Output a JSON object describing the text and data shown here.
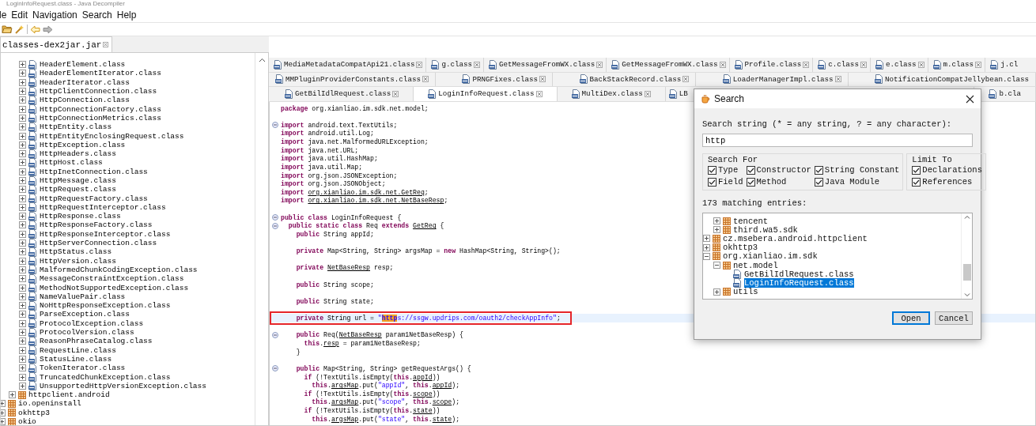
{
  "window": {
    "title": "LoginInfoRequest.class - Java Decompiler"
  },
  "menu": [
    "le",
    "Edit",
    "Navigation",
    "Search",
    "Help"
  ],
  "side_tab": {
    "label": "classes-dex2jar.jar"
  },
  "tree": [
    {
      "children": [
        {
          "children": [
            {
              "label": "HeaderElement.class",
              "kind": "class",
              "expanded": false
            },
            {
              "label": "HeaderElementIterator.class",
              "kind": "class",
              "expanded": false
            },
            {
              "label": "HeaderIterator.class",
              "kind": "class",
              "expanded": false
            },
            {
              "label": "HttpClientConnection.class",
              "kind": "class",
              "expanded": false
            },
            {
              "label": "HttpConnection.class",
              "kind": "class",
              "expanded": false
            },
            {
              "label": "HttpConnectionFactory.class",
              "kind": "class",
              "expanded": false
            },
            {
              "label": "HttpConnectionMetrics.class",
              "kind": "class",
              "expanded": false
            },
            {
              "label": "HttpEntity.class",
              "kind": "class",
              "expanded": false
            },
            {
              "label": "HttpEntityEnclosingRequest.class",
              "kind": "class",
              "expanded": false
            },
            {
              "label": "HttpException.class",
              "kind": "class",
              "expanded": false
            },
            {
              "label": "HttpHeaders.class",
              "kind": "class",
              "expanded": false
            },
            {
              "label": "HttpHost.class",
              "kind": "class",
              "expanded": false
            },
            {
              "label": "HttpInetConnection.class",
              "kind": "class",
              "expanded": false
            },
            {
              "label": "HttpMessage.class",
              "kind": "class",
              "expanded": false
            },
            {
              "label": "HttpRequest.class",
              "kind": "class",
              "expanded": false
            },
            {
              "label": "HttpRequestFactory.class",
              "kind": "class",
              "expanded": false
            },
            {
              "label": "HttpRequestInterceptor.class",
              "kind": "class",
              "expanded": false
            },
            {
              "label": "HttpResponse.class",
              "kind": "class",
              "expanded": false
            },
            {
              "label": "HttpResponseFactory.class",
              "kind": "class",
              "expanded": false
            },
            {
              "label": "HttpResponseInterceptor.class",
              "kind": "class",
              "expanded": false
            },
            {
              "label": "HttpServerConnection.class",
              "kind": "class",
              "expanded": false
            },
            {
              "label": "HttpStatus.class",
              "kind": "class",
              "expanded": false
            },
            {
              "label": "HttpVersion.class",
              "kind": "class",
              "expanded": false
            },
            {
              "label": "MalformedChunkCodingException.class",
              "kind": "class",
              "expanded": false
            },
            {
              "label": "MessageConstraintException.class",
              "kind": "class",
              "expanded": false
            },
            {
              "label": "MethodNotSupportedException.class",
              "kind": "class",
              "expanded": false
            },
            {
              "label": "NameValuePair.class",
              "kind": "class",
              "expanded": false
            },
            {
              "label": "NoHttpResponseException.class",
              "kind": "class",
              "expanded": false
            },
            {
              "label": "ParseException.class",
              "kind": "class",
              "expanded": false
            },
            {
              "label": "ProtocolException.class",
              "kind": "class",
              "expanded": false
            },
            {
              "label": "ProtocolVersion.class",
              "kind": "class",
              "expanded": false
            },
            {
              "label": "ReasonPhraseCatalog.class",
              "kind": "class",
              "expanded": false
            },
            {
              "label": "RequestLine.class",
              "kind": "class",
              "expanded": false
            },
            {
              "label": "StatusLine.class",
              "kind": "class",
              "expanded": false
            },
            {
              "label": "TokenIterator.class",
              "kind": "class",
              "expanded": false
            },
            {
              "label": "TruncatedChunkException.class",
              "kind": "class",
              "expanded": false
            },
            {
              "label": "UnsupportedHttpVersionException.class",
              "kind": "class",
              "expanded": false
            }
          ]
        },
        {
          "label": "httpclient.android",
          "kind": "package",
          "expanded": false
        }
      ]
    },
    {
      "label": "io.openinstall",
      "kind": "package",
      "expanded": false
    },
    {
      "label": "okhttp3",
      "kind": "package",
      "expanded": false
    },
    {
      "label": "okio",
      "kind": "package",
      "expanded": false
    }
  ],
  "tab_rows": [
    {
      "tabs": [
        {
          "label": "MediaMetadataCompatApi21.class",
          "selected": false,
          "closable": true
        },
        {
          "label": "g.class",
          "selected": false,
          "closable": true
        },
        {
          "label": "GetMessageFromWX.class",
          "selected": false,
          "closable": true
        },
        {
          "label": "GetMessageFromWX.class",
          "selected": false,
          "closable": true
        },
        {
          "label": "Profile.class",
          "selected": false,
          "closable": true
        },
        {
          "label": "c.class",
          "selected": false,
          "closable": true
        },
        {
          "label": "e.class",
          "selected": false,
          "closable": true
        },
        {
          "label": "m.class",
          "selected": false,
          "closable": true
        },
        {
          "label": "j.cl",
          "selected": false,
          "closable": false
        }
      ]
    },
    {
      "tabs": [
        {
          "label": "MMPluginProviderConstants.class",
          "selected": false,
          "closable": true
        },
        {
          "label": "PRNGFixes.class",
          "selected": false,
          "closable": true
        },
        {
          "label": "BackStackRecord.class",
          "selected": false,
          "closable": true
        },
        {
          "label": "LoaderManagerImpl.class",
          "selected": false,
          "closable": true
        },
        {
          "label": "NotificationCompatJellybean.class",
          "selected": false,
          "closable": false
        }
      ]
    },
    {
      "tabs": [
        {
          "label": "GetBilIdlRequest.class",
          "selected": false,
          "closable": true
        },
        {
          "label": "LoginInfoRequest.class",
          "selected": true,
          "closable": true
        },
        {
          "label": "MultiDex.class",
          "selected": false,
          "closable": true
        },
        {
          "label": "LB",
          "selected": false,
          "closable": false
        },
        {
          "label": "b.cla",
          "selected": false,
          "closable": false
        }
      ]
    }
  ],
  "code": {
    "lines": [
      {
        "kind": "code",
        "tokens": [
          {
            "kind": "kw",
            "text": "package"
          },
          {
            "kind": "plain",
            "text": " org.xianliao.im.sdk.net.model;"
          }
        ]
      },
      {
        "kind": "blank"
      },
      {
        "kind": "code",
        "fold": true,
        "tokens": [
          {
            "kind": "kw",
            "text": "import"
          },
          {
            "kind": "plain",
            "text": " android.text.TextUtils;"
          }
        ]
      },
      {
        "kind": "code",
        "tokens": [
          {
            "kind": "kw",
            "text": "import"
          },
          {
            "kind": "plain",
            "text": " android.util.Log;"
          }
        ]
      },
      {
        "kind": "code",
        "tokens": [
          {
            "kind": "kw",
            "text": "import"
          },
          {
            "kind": "plain",
            "text": " java.net.MalformedURLException;"
          }
        ]
      },
      {
        "kind": "code",
        "tokens": [
          {
            "kind": "kw",
            "text": "import"
          },
          {
            "kind": "plain",
            "text": " java.net.URL;"
          }
        ]
      },
      {
        "kind": "code",
        "tokens": [
          {
            "kind": "kw",
            "text": "import"
          },
          {
            "kind": "plain",
            "text": " java.util.HashMap;"
          }
        ]
      },
      {
        "kind": "code",
        "tokens": [
          {
            "kind": "kw",
            "text": "import"
          },
          {
            "kind": "plain",
            "text": " java.util.Map;"
          }
        ]
      },
      {
        "kind": "code",
        "tokens": [
          {
            "kind": "kw",
            "text": "import"
          },
          {
            "kind": "plain",
            "text": " org.json.JSONException;"
          }
        ]
      },
      {
        "kind": "code",
        "tokens": [
          {
            "kind": "kw",
            "text": "import"
          },
          {
            "kind": "plain",
            "text": " org.json.JSONObject;"
          }
        ]
      },
      {
        "kind": "code",
        "tokens": [
          {
            "kind": "kw",
            "text": "import "
          },
          {
            "kind": "link",
            "text": "org.xianliao.im.sdk.net.GetReq"
          },
          {
            "kind": "plain",
            "text": ";"
          }
        ]
      },
      {
        "kind": "code",
        "tokens": [
          {
            "kind": "kw",
            "text": "import "
          },
          {
            "kind": "link",
            "text": "org.xianliao.im.sdk.net.NetBaseResp"
          },
          {
            "kind": "plain",
            "text": ";"
          }
        ]
      },
      {
        "kind": "blank"
      },
      {
        "kind": "code",
        "fold": true,
        "tokens": [
          {
            "kind": "kw",
            "text": "public class"
          },
          {
            "kind": "plain",
            "text": " LoginInfoRequest {"
          }
        ]
      },
      {
        "kind": "code",
        "fold": true,
        "tokens": [
          {
            "kind": "kw",
            "text": "  public static class"
          },
          {
            "kind": "plain",
            "text": " Req "
          },
          {
            "kind": "kw",
            "text": "extends "
          },
          {
            "kind": "link",
            "text": "GetReq"
          },
          {
            "kind": "plain",
            "text": " {"
          }
        ]
      },
      {
        "kind": "code",
        "tokens": [
          {
            "kind": "kw",
            "text": "    public"
          },
          {
            "kind": "plain",
            "text": " String appId;"
          }
        ]
      },
      {
        "kind": "blank"
      },
      {
        "kind": "code",
        "tokens": [
          {
            "kind": "kw",
            "text": "    private"
          },
          {
            "kind": "plain",
            "text": " Map<String, String> argsMap = "
          },
          {
            "kind": "kw",
            "text": "new"
          },
          {
            "kind": "plain",
            "text": " HashMap<String, String>();"
          }
        ]
      },
      {
        "kind": "blank"
      },
      {
        "kind": "code",
        "tokens": [
          {
            "kind": "kw",
            "text": "    private "
          },
          {
            "kind": "link",
            "text": "NetBaseResp"
          },
          {
            "kind": "plain",
            "text": " resp;"
          }
        ]
      },
      {
        "kind": "blank"
      },
      {
        "kind": "code",
        "tokens": [
          {
            "kind": "kw",
            "text": "    public"
          },
          {
            "kind": "plain",
            "text": " String scope;"
          }
        ]
      },
      {
        "kind": "blank"
      },
      {
        "kind": "code",
        "tokens": [
          {
            "kind": "kw",
            "text": "    public"
          },
          {
            "kind": "plain",
            "text": " String state;"
          }
        ]
      },
      {
        "kind": "blank"
      },
      {
        "kind": "code",
        "current": true,
        "marked": true,
        "tokens": [
          {
            "kind": "kw",
            "text": "    private"
          },
          {
            "kind": "plain",
            "text": " String url = "
          },
          {
            "kind": "str",
            "text": "\""
          },
          {
            "kind": "match",
            "text": "http"
          },
          {
            "kind": "str",
            "text": "s://ssgw.updrips.com/oauth2/checkAppInfo\""
          },
          {
            "kind": "plain",
            "text": ";"
          }
        ]
      },
      {
        "kind": "blank"
      },
      {
        "kind": "code",
        "fold": true,
        "tokens": [
          {
            "kind": "kw",
            "text": "    public"
          },
          {
            "kind": "plain",
            "text": " Req("
          },
          {
            "kind": "link",
            "text": "NetBaseResp"
          },
          {
            "kind": "plain",
            "text": " param1NetBaseResp) {"
          }
        ]
      },
      {
        "kind": "code",
        "tokens": [
          {
            "kind": "kw",
            "text": "      this"
          },
          {
            "kind": "plain",
            "text": "."
          },
          {
            "kind": "link",
            "text": "resp"
          },
          {
            "kind": "plain",
            "text": " = param1NetBaseResp;"
          }
        ]
      },
      {
        "kind": "code",
        "tokens": [
          {
            "kind": "plain",
            "text": "    }"
          }
        ]
      },
      {
        "kind": "blank"
      },
      {
        "kind": "code",
        "fold": true,
        "tokens": [
          {
            "kind": "kw",
            "text": "    public"
          },
          {
            "kind": "plain",
            "text": " Map<String, String> getRequestArgs() {"
          }
        ]
      },
      {
        "kind": "code",
        "tokens": [
          {
            "kind": "kw",
            "text": "      if"
          },
          {
            "kind": "plain",
            "text": " (!TextUtils.isEmpty("
          },
          {
            "kind": "kw",
            "text": "this"
          },
          {
            "kind": "plain",
            "text": "."
          },
          {
            "kind": "link",
            "text": "appId"
          },
          {
            "kind": "plain",
            "text": "))"
          }
        ]
      },
      {
        "kind": "code",
        "tokens": [
          {
            "kind": "kw",
            "text": "        this"
          },
          {
            "kind": "plain",
            "text": "."
          },
          {
            "kind": "link",
            "text": "argsMap"
          },
          {
            "kind": "plain",
            "text": ".put("
          },
          {
            "kind": "str",
            "text": "\"appId\""
          },
          {
            "kind": "plain",
            "text": ", "
          },
          {
            "kind": "kw",
            "text": "this"
          },
          {
            "kind": "plain",
            "text": "."
          },
          {
            "kind": "link",
            "text": "appId"
          },
          {
            "kind": "plain",
            "text": ");"
          }
        ]
      },
      {
        "kind": "code",
        "tokens": [
          {
            "kind": "kw",
            "text": "      if"
          },
          {
            "kind": "plain",
            "text": " (!TextUtils.isEmpty("
          },
          {
            "kind": "kw",
            "text": "this"
          },
          {
            "kind": "plain",
            "text": "."
          },
          {
            "kind": "link",
            "text": "scope"
          },
          {
            "kind": "plain",
            "text": "))"
          }
        ]
      },
      {
        "kind": "code",
        "tokens": [
          {
            "kind": "kw",
            "text": "        this"
          },
          {
            "kind": "plain",
            "text": "."
          },
          {
            "kind": "link",
            "text": "argsMap"
          },
          {
            "kind": "plain",
            "text": ".put("
          },
          {
            "kind": "str",
            "text": "\"scope\""
          },
          {
            "kind": "plain",
            "text": ", "
          },
          {
            "kind": "kw",
            "text": "this"
          },
          {
            "kind": "plain",
            "text": "."
          },
          {
            "kind": "link",
            "text": "scope"
          },
          {
            "kind": "plain",
            "text": ");"
          }
        ]
      },
      {
        "kind": "code",
        "tokens": [
          {
            "kind": "kw",
            "text": "      if"
          },
          {
            "kind": "plain",
            "text": " (!TextUtils.isEmpty("
          },
          {
            "kind": "kw",
            "text": "this"
          },
          {
            "kind": "plain",
            "text": "."
          },
          {
            "kind": "link",
            "text": "state"
          },
          {
            "kind": "plain",
            "text": "))"
          }
        ]
      },
      {
        "kind": "code",
        "tokens": [
          {
            "kind": "kw",
            "text": "        this"
          },
          {
            "kind": "plain",
            "text": "."
          },
          {
            "kind": "link",
            "text": "argsMap"
          },
          {
            "kind": "plain",
            "text": ".put("
          },
          {
            "kind": "str",
            "text": "\"state\""
          },
          {
            "kind": "plain",
            "text": ", "
          },
          {
            "kind": "kw",
            "text": "this"
          },
          {
            "kind": "plain",
            "text": "."
          },
          {
            "kind": "link",
            "text": "state"
          },
          {
            "kind": "plain",
            "text": ");"
          }
        ]
      }
    ]
  },
  "search_dialog": {
    "title": "Search",
    "prompt": "Search string (* = any string, ? = any character):",
    "query": "http",
    "search_for": {
      "title": "Search For",
      "options": [
        {
          "label": "Type",
          "checked": true
        },
        {
          "label": "Constructor",
          "checked": true
        },
        {
          "label": "String Constant",
          "checked": true
        },
        {
          "label": "Field",
          "checked": true
        },
        {
          "label": "Method",
          "checked": true
        },
        {
          "label": "Java Module",
          "checked": true
        }
      ]
    },
    "limit_to": {
      "title": "Limit To",
      "options": [
        {
          "label": "Declarations",
          "checked": true
        },
        {
          "label": "References",
          "checked": true
        }
      ]
    },
    "count": "173 matching entries:",
    "results": [
      {
        "children": [
          {
            "label": "tencent",
            "kind": "package",
            "expanded": false,
            "selected": false
          },
          {
            "label": "third.wa5.sdk",
            "kind": "package",
            "expanded": false,
            "selected": false
          }
        ]
      },
      {
        "label": "cz.msebera.android.httpclient",
        "kind": "package",
        "expanded": false,
        "selected": false
      },
      {
        "label": "okhttp3",
        "kind": "package",
        "expanded": false,
        "selected": false
      },
      {
        "label": "org.xianliao.im.sdk",
        "kind": "package",
        "expanded": true,
        "selected": false,
        "children": [
          {
            "label": "net.model",
            "kind": "package",
            "expanded": true,
            "selected": false,
            "children": [
              {
                "label": "GetBilIdlRequest.class",
                "kind": "class",
                "selected": false
              },
              {
                "label": "LoginInfoRequest.class",
                "kind": "class",
                "selected": true
              }
            ]
          },
          {
            "label": "utils",
            "kind": "package",
            "expanded": false,
            "selected": false
          }
        ]
      }
    ],
    "buttons": [
      {
        "label": "Open",
        "default": true
      },
      {
        "label": "Cancel",
        "default": false
      }
    ]
  }
}
